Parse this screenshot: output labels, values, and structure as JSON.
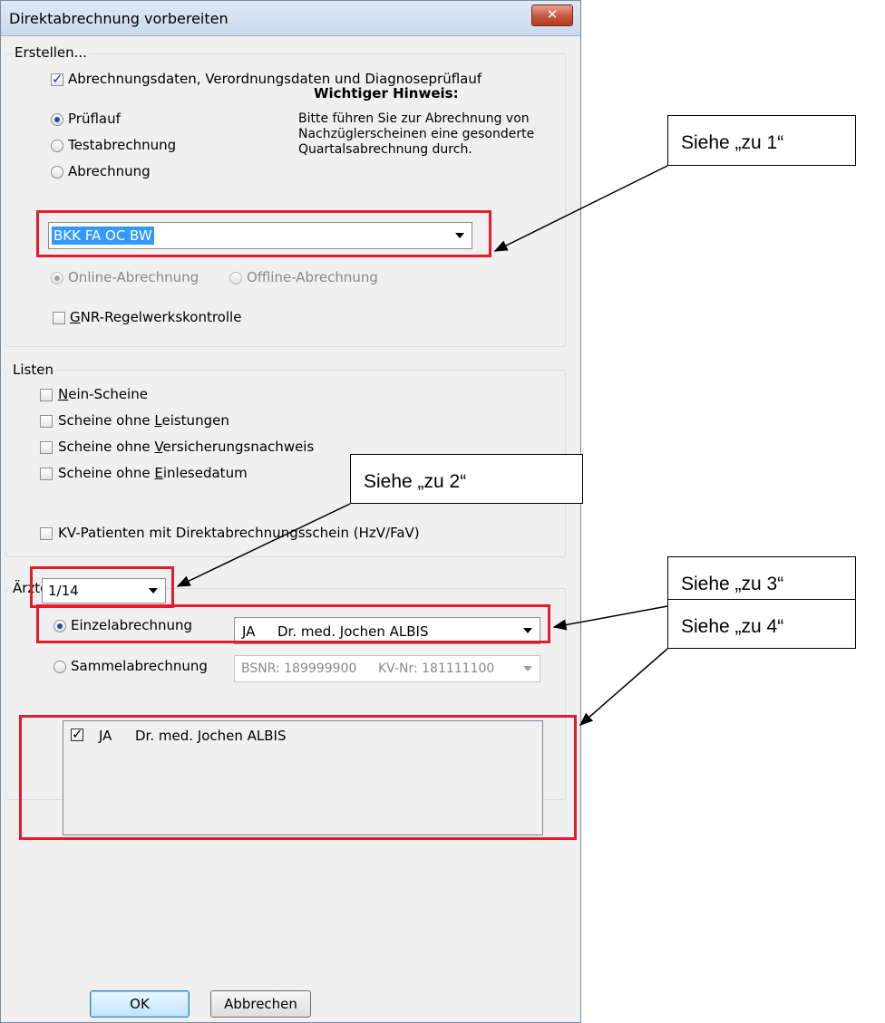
{
  "window": {
    "title": "Direktabrechnung vorbereiten",
    "close_icon": "close-icon"
  },
  "erstellen": {
    "label": "Erstellen...",
    "data_checkbox": {
      "label": "Abrechnungsdaten, Verordnungsdaten und Diagnoseprüflauf",
      "checked": true
    },
    "modes": [
      {
        "label": "Prüflauf",
        "checked": true
      },
      {
        "label": "Testabrechnung",
        "checked": false
      },
      {
        "label": "Abrechnung",
        "checked": false
      }
    ],
    "hint_title": "Wichtiger Hinweis",
    "hint_colon": ":",
    "hint_lines": [
      "Bitte führen Sie zur Abrechnung von",
      "Nachzüglerscheinen eine gesonderte",
      "Quartalsabrechnung durch."
    ],
    "kasse_select": {
      "value": "BKK FA OC BW"
    },
    "online_label": "Online-Abrechnung",
    "offline_label": "Offline-Abrechnung",
    "gnr": {
      "label_u": "G",
      "label_rest": "NR-Regelwerkskontrolle",
      "checked": false
    }
  },
  "listen": {
    "label": "Listen",
    "items": [
      {
        "pre": "",
        "u": "N",
        "post": "ein-Scheine"
      },
      {
        "pre": "Scheine ohne ",
        "u": "L",
        "post": "eistungen"
      },
      {
        "pre": "Scheine ohne ",
        "u": "V",
        "post": "ersicherungsnachweis"
      },
      {
        "pre": "Scheine ohne ",
        "u": "E",
        "post": "inlesedatum"
      }
    ],
    "kv_patients": "KV-Patienten mit Direktabrechnungsschein (HzV/FaV)"
  },
  "aerzte": {
    "label": "Ärzte",
    "quarter_select": "1/14",
    "einzel": {
      "label": "Einzelabrechnung",
      "checked": true,
      "code": "JA",
      "name": "Dr. med. Jochen ALBIS"
    },
    "sammel": {
      "label": "Sammelabrechnung",
      "checked": false,
      "bsnr": "BSNR: 189999900",
      "kvnr": "KV-Nr: 181111100"
    },
    "doctor_list": [
      {
        "code": "JA",
        "name": "Dr. med. Jochen ALBIS",
        "checked": true
      }
    ]
  },
  "buttons": {
    "ok": "OK",
    "cancel": "Abbrechen"
  },
  "callouts": [
    "Siehe „zu 1“",
    "Siehe „zu 2“",
    "Siehe „zu 3“",
    "Siehe „zu 4“"
  ]
}
